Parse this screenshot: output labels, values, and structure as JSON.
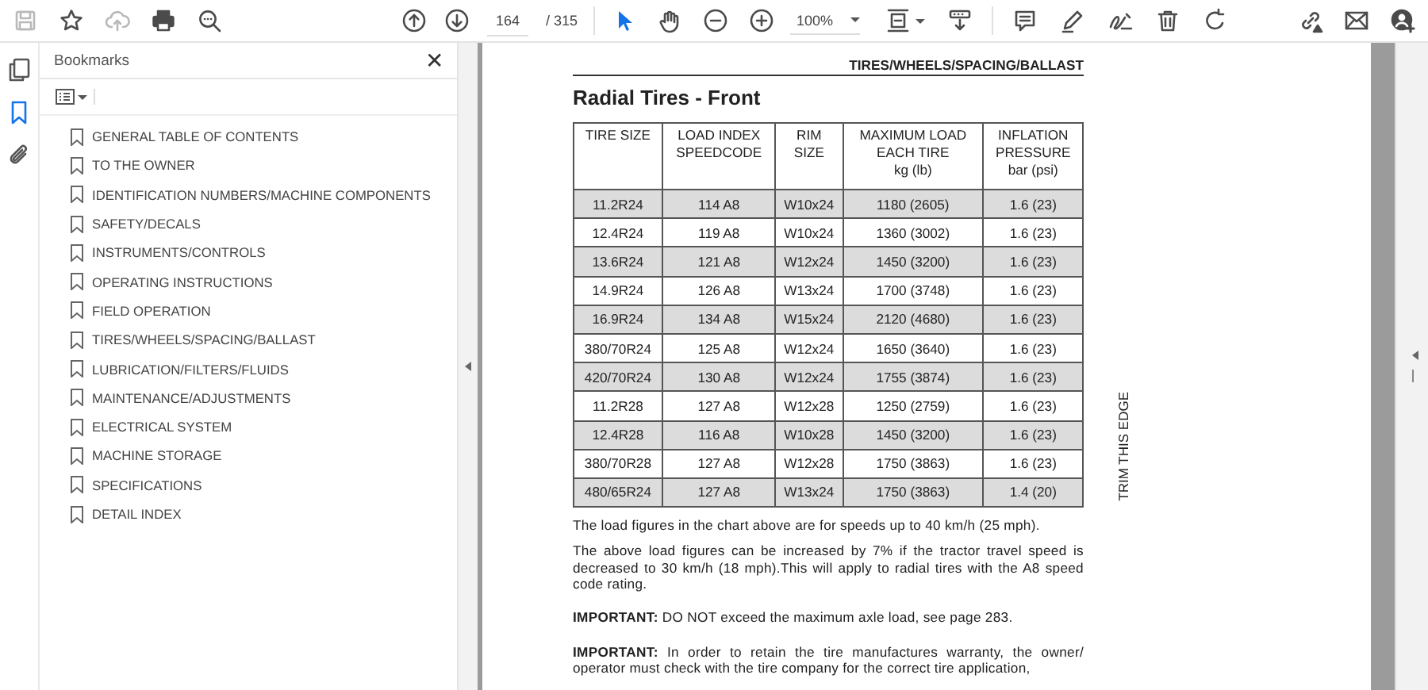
{
  "toolbar": {
    "left_tools": [
      {
        "kind": "save",
        "disabled": true
      },
      {
        "kind": "star",
        "disabled": false
      },
      {
        "kind": "cloud",
        "disabled": true
      },
      {
        "kind": "print",
        "disabled": false
      },
      {
        "kind": "search",
        "disabled": false
      }
    ],
    "page_number": "164",
    "page_total": "/ 315",
    "view_tools": [
      {
        "kind": "pointer",
        "selected": true
      },
      {
        "kind": "hand",
        "selected": false
      },
      {
        "kind": "zoom-out",
        "selected": false
      },
      {
        "kind": "zoom-in",
        "selected": false
      }
    ],
    "zoom": "100%",
    "edit_tools": [
      {
        "kind": "comment"
      },
      {
        "kind": "pen"
      },
      {
        "kind": "sign"
      },
      {
        "kind": "trash"
      },
      {
        "kind": "rotate"
      }
    ],
    "right_tools": [
      {
        "kind": "link"
      },
      {
        "kind": "mail"
      },
      {
        "kind": "account"
      }
    ]
  },
  "sidebar": {
    "rail": [
      {
        "kind": "pages",
        "selected": false
      },
      {
        "kind": "bookmark",
        "selected": true
      },
      {
        "kind": "attachment",
        "selected": false
      }
    ]
  },
  "bookmarks": {
    "title": "Bookmarks",
    "close": "✕",
    "items": [
      {
        "label": "GENERAL TABLE OF CONTENTS"
      },
      {
        "label": "TO THE OWNER"
      },
      {
        "label": "IDENTIFICATION NUMBERS/MACHINE COMPONENTS"
      },
      {
        "label": "SAFETY/DECALS"
      },
      {
        "label": "INSTRUMENTS/CONTROLS"
      },
      {
        "label": "OPERATING INSTRUCTIONS"
      },
      {
        "label": "FIELD OPERATION"
      },
      {
        "label": "TIRES/WHEELS/SPACING/BALLAST"
      },
      {
        "label": "LUBRICATION/FILTERS/FLUIDS"
      },
      {
        "label": "MAINTENANCE/ADJUSTMENTS"
      },
      {
        "label": "ELECTRICAL SYSTEM"
      },
      {
        "label": "MACHINE STORAGE"
      },
      {
        "label": "SPECIFICATIONS"
      },
      {
        "label": "DETAIL INDEX"
      }
    ]
  },
  "document": {
    "header": "TIRES/WHEELS/SPACING/BALLAST",
    "title": "Radial Tires - Front",
    "table": {
      "columns": [
        "TIRE SIZE",
        "LOAD INDEX\nSPEEDCODE",
        "RIM\nSIZE",
        "MAXIMUM LOAD\nEACH TIRE\nkg (lb)",
        "INFLATION\nPRESSURE\nbar (psi)"
      ],
      "rows": [
        {
          "cells": [
            "11.2R24",
            "114 A8",
            "W10x24",
            "1180 (2605)",
            "1.6 (23)"
          ],
          "shaded": true
        },
        {
          "cells": [
            "12.4R24",
            "119 A8",
            "W10x24",
            "1360 (3002)",
            "1.6 (23)"
          ],
          "shaded": false
        },
        {
          "cells": [
            "13.6R24",
            "121 A8",
            "W12x24",
            "1450 (3200)",
            "1.6 (23)"
          ],
          "shaded": true
        },
        {
          "cells": [
            "14.9R24",
            "126 A8",
            "W13x24",
            "1700 (3748)",
            "1.6 (23)"
          ],
          "shaded": false
        },
        {
          "cells": [
            "16.9R24",
            "134 A8",
            "W15x24",
            "2120 (4680)",
            "1.6 (23)"
          ],
          "shaded": true
        },
        {
          "cells": [
            "380/70R24",
            "125 A8",
            "W12x24",
            "1650 (3640)",
            "1.6 (23)"
          ],
          "shaded": false
        },
        {
          "cells": [
            "420/70R24",
            "130 A8",
            "W12x24",
            "1755 (3874)",
            "1.6 (23)"
          ],
          "shaded": true
        },
        {
          "cells": [
            "11.2R28",
            "127 A8",
            "W12x28",
            "1250 (2759)",
            "1.6 (23)"
          ],
          "shaded": false
        },
        {
          "cells": [
            "12.4R28",
            "116 A8",
            "W10x28",
            "1450 (3200)",
            "1.6 (23)"
          ],
          "shaded": true
        },
        {
          "cells": [
            "380/70R28",
            "127 A8",
            "W12x28",
            "1750 (3863)",
            "1.6 (23)"
          ],
          "shaded": false
        },
        {
          "cells": [
            "480/65R24",
            "127 A8",
            "W13x24",
            "1750 (3863)",
            "1.4 (20)"
          ],
          "shaded": true
        }
      ]
    },
    "paragraphs": [
      "The load figures in the chart above are for speeds up to 40 km/h (25 mph).",
      "The above load figures can be increased by 7% if the tractor travel speed is decreased to 30 km/h (18 mph).This will apply to radial tires with the A8 speed code rating.",
      "**IMPORTANT:** DO NOT exceed the maximum axle load, see page 283.",
      "**IMPORTANT:** In order to retain the tire manufactures warranty, the owner/ operator must check with the tire company for the correct tire application,"
    ],
    "margin_note": "TRIM THIS EDGE"
  }
}
